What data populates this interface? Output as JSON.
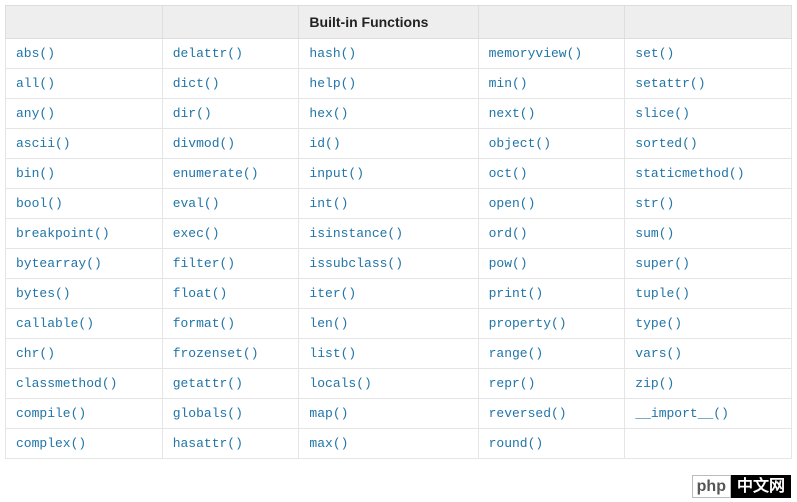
{
  "header": {
    "col1": "",
    "col2": "",
    "col3": "Built-in Functions",
    "col4": "",
    "col5": ""
  },
  "rows": [
    [
      "abs()",
      "delattr()",
      "hash()",
      "memoryview()",
      "set()"
    ],
    [
      "all()",
      "dict()",
      "help()",
      "min()",
      "setattr()"
    ],
    [
      "any()",
      "dir()",
      "hex()",
      "next()",
      "slice()"
    ],
    [
      "ascii()",
      "divmod()",
      "id()",
      "object()",
      "sorted()"
    ],
    [
      "bin()",
      "enumerate()",
      "input()",
      "oct()",
      "staticmethod()"
    ],
    [
      "bool()",
      "eval()",
      "int()",
      "open()",
      "str()"
    ],
    [
      "breakpoint()",
      "exec()",
      "isinstance()",
      "ord()",
      "sum()"
    ],
    [
      "bytearray()",
      "filter()",
      "issubclass()",
      "pow()",
      "super()"
    ],
    [
      "bytes()",
      "float()",
      "iter()",
      "print()",
      "tuple()"
    ],
    [
      "callable()",
      "format()",
      "len()",
      "property()",
      "type()"
    ],
    [
      "chr()",
      "frozenset()",
      "list()",
      "range()",
      "vars()"
    ],
    [
      "classmethod()",
      "getattr()",
      "locals()",
      "repr()",
      "zip()"
    ],
    [
      "compile()",
      "globals()",
      "map()",
      "reversed()",
      "__import__()"
    ],
    [
      "complex()",
      "hasattr()",
      "max()",
      "round()",
      ""
    ]
  ],
  "watermark": {
    "php": "php",
    "cn": "中文网"
  }
}
